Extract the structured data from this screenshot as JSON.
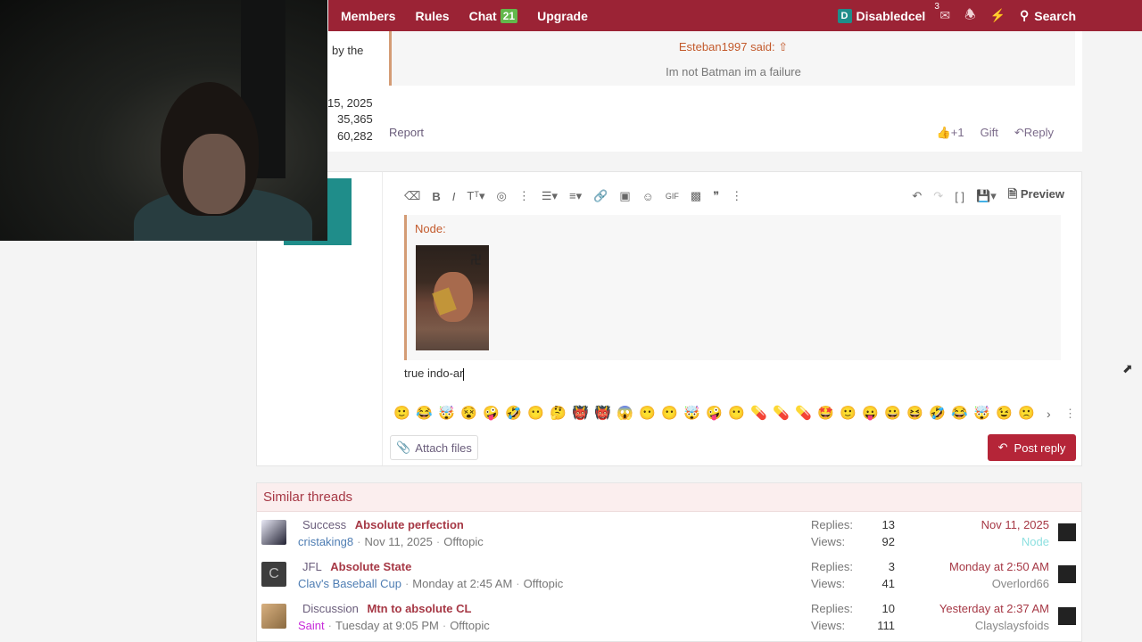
{
  "nav": {
    "items": [
      "Members",
      "Rules",
      "Chat"
    ],
    "chat_count": "21",
    "upgrade": "Upgrade",
    "user_initial": "D",
    "username": "Disabledcel",
    "inbox_count": "3",
    "search": "Search"
  },
  "sidebar_fragments": {
    "by_the": "by the",
    "joined": "15, 2025",
    "posts": "35,365",
    "reputation": "60,282"
  },
  "quote": {
    "author": "Esteban1997 said:",
    "text": "Im not Batman im a failure"
  },
  "post_actions": {
    "report": "Report",
    "like": "+1",
    "gift": "Gift",
    "reply": "Reply"
  },
  "editor": {
    "preview": "Preview",
    "quoted_user": "Node:",
    "typed_text": "true indo-ar",
    "attach": "Attach files",
    "post_reply": "Post reply",
    "smilies": [
      "🙂",
      "😂",
      "🤯",
      "😵",
      "🤪",
      "🤣",
      "😶",
      "🤔",
      "👹",
      "👹",
      "😱",
      "😶",
      "😶",
      "🤯",
      "🤪",
      "😶",
      "💊",
      "💊",
      "💊",
      "🤩",
      "🙂",
      "😛",
      "😀",
      "😆",
      "🤣",
      "😂",
      "🤯",
      "😉",
      "🙁"
    ]
  },
  "similar": {
    "title": "Similar threads",
    "replies_label": "Replies:",
    "views_label": "Views:",
    "threads": [
      {
        "prefix": "Success",
        "title": "Absolute perfection",
        "author": "cristaking8",
        "date": "Nov 11, 2025",
        "forum": "Offtopic",
        "replies": "13",
        "views": "92",
        "last_date": "Nov 11, 2025",
        "last_user": "Node"
      },
      {
        "prefix": "JFL",
        "title": "Absolute State",
        "author": "Clav's Baseball Cup",
        "date": "Monday at 2:45 AM",
        "forum": "Offtopic",
        "replies": "3",
        "views": "41",
        "last_date": "Monday at 2:50 AM",
        "last_user": "Overlord66"
      },
      {
        "prefix": "Discussion",
        "title": "Mtn to absolute CL",
        "author": "Saint",
        "date": "Tuesday at 9:05 PM",
        "forum": "Offtopic",
        "replies": "10",
        "views": "111",
        "last_date": "Yesterday at 2:37 AM",
        "last_user": "Clayslaysfoids"
      }
    ]
  }
}
